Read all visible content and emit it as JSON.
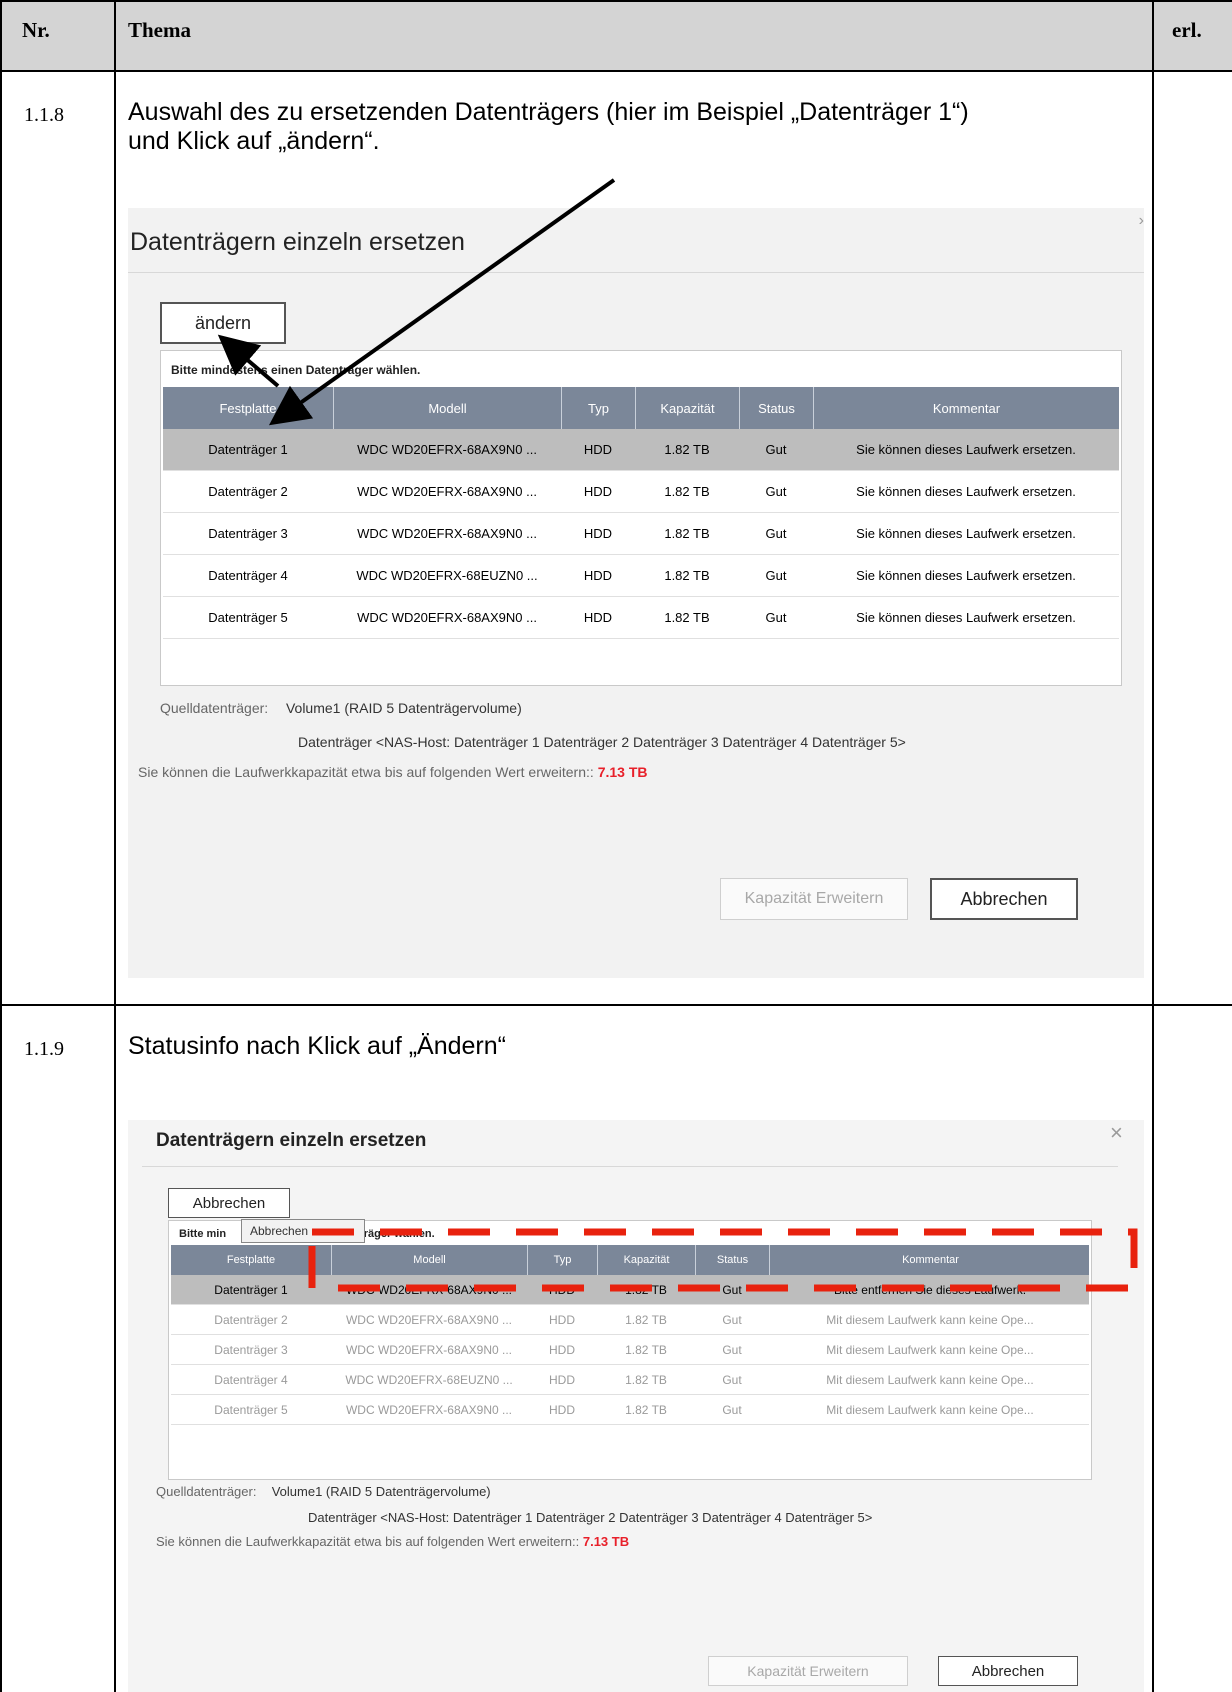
{
  "header": {
    "nr": "Nr.",
    "thema": "Thema",
    "erl": "erl."
  },
  "rows": [
    {
      "nr": "1.1.8",
      "desc_line1": "Auswahl des zu ersetzenden Datenträgers (hier im Beispiel „Datenträger 1“)",
      "desc_line2": "und Klick auf „ändern“.",
      "dialog": {
        "title": "Datenträgern einzeln ersetzen",
        "action_button": "ändern",
        "hint": "Bitte mindestens einen Datenträger wählen.",
        "columns": [
          "Festplatte",
          "Modell",
          "Typ",
          "Kapazität",
          "Status",
          "Kommentar"
        ],
        "disks": [
          [
            "Datenträger 1",
            "WDC WD20EFRX-68AX9N0 ...",
            "HDD",
            "1.82 TB",
            "Gut",
            "Sie können dieses Laufwerk ersetzen."
          ],
          [
            "Datenträger 2",
            "WDC WD20EFRX-68AX9N0 ...",
            "HDD",
            "1.82 TB",
            "Gut",
            "Sie können dieses Laufwerk ersetzen."
          ],
          [
            "Datenträger 3",
            "WDC WD20EFRX-68AX9N0 ...",
            "HDD",
            "1.82 TB",
            "Gut",
            "Sie können dieses Laufwerk ersetzen."
          ],
          [
            "Datenträger 4",
            "WDC WD20EFRX-68EUZN0 ...",
            "HDD",
            "1.82 TB",
            "Gut",
            "Sie können dieses Laufwerk ersetzen."
          ],
          [
            "Datenträger 5",
            "WDC WD20EFRX-68AX9N0 ...",
            "HDD",
            "1.82 TB",
            "Gut",
            "Sie können dieses Laufwerk ersetzen."
          ]
        ],
        "source_label": "Quelldatenträger:",
        "source_value": "Volume1 (RAID 5 Datenträgervolume)",
        "source_disks": "Datenträger <NAS-Host: Datenträger 1 Datenträger 2 Datenträger 3 Datenträger 4 Datenträger 5>",
        "capacity_text": "Sie können die Laufwerkkapazität etwa bis auf folgenden Wert erweitern::",
        "capacity_value": "7.13 TB",
        "expand_button": "Kapazität Erweitern",
        "cancel_button": "Abbrechen"
      }
    },
    {
      "nr": "1.1.9",
      "desc_line1": "Statusinfo nach Klick auf „Ändern“",
      "dialog": {
        "title": "Datenträgern einzeln ersetzen",
        "close_icon": "×",
        "action_button": "Abbrechen",
        "hint": "Bitte min",
        "hint_end": "träger wählen.",
        "tooltip": "Abbrechen",
        "columns": [
          "Festplatte",
          "Modell",
          "Typ",
          "Kapazität",
          "Status",
          "Kommentar"
        ],
        "disks": [
          [
            "Datenträger 1",
            "WDC WD20EFRX-68AX9N0 ...",
            "HDD",
            "1.82 TB",
            "Gut",
            "Bitte entfernen Sie dieses Laufwerk."
          ],
          [
            "Datenträger 2",
            "WDC WD20EFRX-68AX9N0 ...",
            "HDD",
            "1.82 TB",
            "Gut",
            "Mit diesem Laufwerk kann keine Ope..."
          ],
          [
            "Datenträger 3",
            "WDC WD20EFRX-68AX9N0 ...",
            "HDD",
            "1.82 TB",
            "Gut",
            "Mit diesem Laufwerk kann keine Ope..."
          ],
          [
            "Datenträger 4",
            "WDC WD20EFRX-68EUZN0 ...",
            "HDD",
            "1.82 TB",
            "Gut",
            "Mit diesem Laufwerk kann keine Ope..."
          ],
          [
            "Datenträger 5",
            "WDC WD20EFRX-68AX9N0 ...",
            "HDD",
            "1.82 TB",
            "Gut",
            "Mit diesem Laufwerk kann keine Ope..."
          ]
        ],
        "source_label": "Quelldatenträger:",
        "source_value": "Volume1 (RAID 5 Datenträgervolume)",
        "source_disks": "Datenträger <NAS-Host: Datenträger 1 Datenträger 2 Datenträger 3 Datenträger 4 Datenträger 5>",
        "capacity_text": "Sie können die Laufwerkkapazität etwa bis auf folgenden Wert erweitern::",
        "capacity_value": "7.13 TB",
        "expand_button": "Kapazität Erweitern",
        "cancel_button": "Abbrechen"
      }
    }
  ],
  "colors": {
    "header_bg": "#d4d4d4",
    "table_header": "#7b8799",
    "selected_row": "#bdbdbd",
    "capacity_red": "#e8202a",
    "dash_red": "#e8220e"
  }
}
